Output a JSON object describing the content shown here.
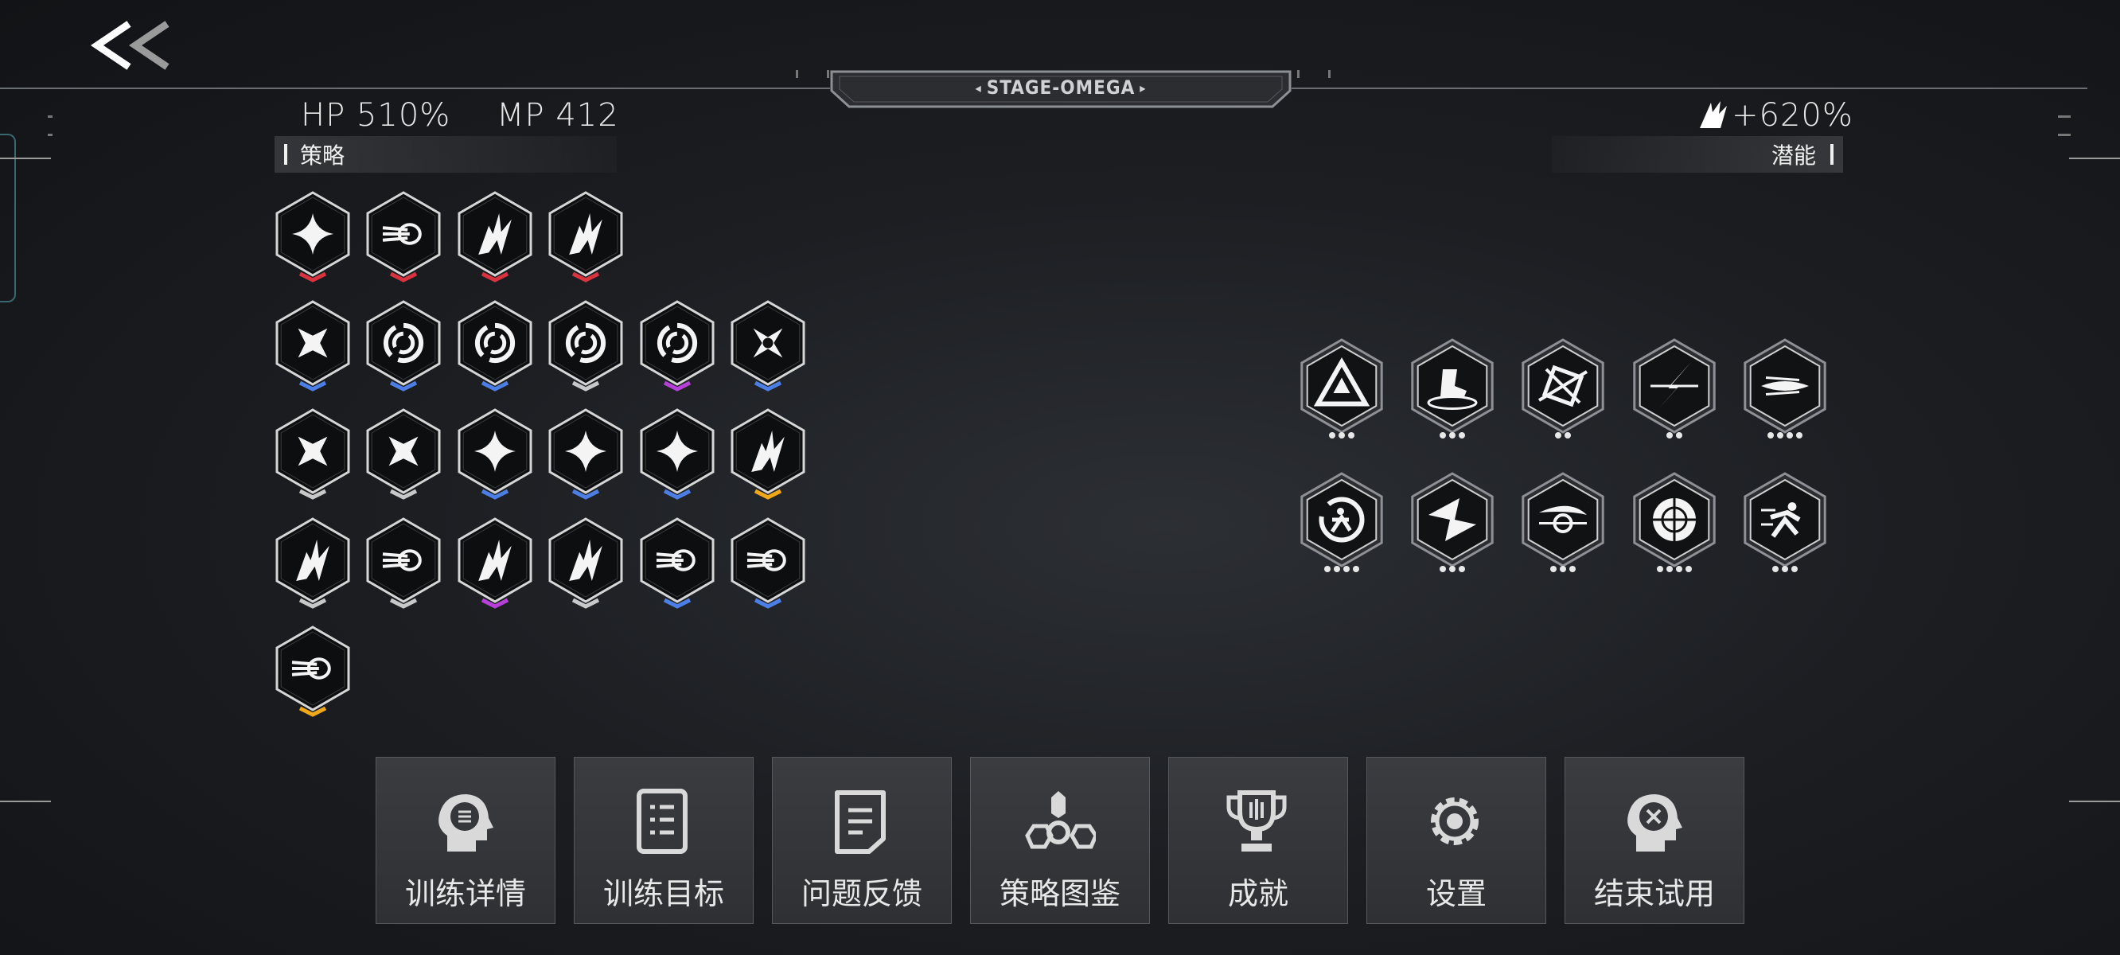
{
  "header": {
    "stage": "STAGE-OMEGA",
    "hp": "HP 510%",
    "mp": "MP 412",
    "boost": "+620%"
  },
  "sections": {
    "strategy": "策略",
    "potential": "潜能"
  },
  "strategy_icons": [
    {
      "row": 0,
      "col": 0,
      "icon": "sparkle-star-icon",
      "tier": "red"
    },
    {
      "row": 0,
      "col": 1,
      "icon": "dash-bolt-icon",
      "tier": "red"
    },
    {
      "row": 0,
      "col": 2,
      "icon": "claw-slash-icon",
      "tier": "red"
    },
    {
      "row": 0,
      "col": 3,
      "icon": "claw-slash-icon",
      "tier": "red"
    },
    {
      "row": 1,
      "col": 0,
      "icon": "shuriken-icon",
      "tier": "blue"
    },
    {
      "row": 1,
      "col": 1,
      "icon": "vortex-icon",
      "tier": "blue"
    },
    {
      "row": 1,
      "col": 2,
      "icon": "vortex-icon",
      "tier": "blue"
    },
    {
      "row": 1,
      "col": 3,
      "icon": "vortex-icon",
      "tier": "white"
    },
    {
      "row": 1,
      "col": 4,
      "icon": "vortex-icon",
      "tier": "purple"
    },
    {
      "row": 1,
      "col": 5,
      "icon": "compass-star-icon",
      "tier": "blue"
    },
    {
      "row": 2,
      "col": 0,
      "icon": "shuriken-icon",
      "tier": "white"
    },
    {
      "row": 2,
      "col": 1,
      "icon": "shuriken-icon",
      "tier": "white"
    },
    {
      "row": 2,
      "col": 2,
      "icon": "sparkle-star-icon",
      "tier": "blue"
    },
    {
      "row": 2,
      "col": 3,
      "icon": "sparkle-star-icon",
      "tier": "blue"
    },
    {
      "row": 2,
      "col": 4,
      "icon": "sparkle-star-icon",
      "tier": "blue"
    },
    {
      "row": 2,
      "col": 5,
      "icon": "claw-slash-icon",
      "tier": "gold"
    },
    {
      "row": 3,
      "col": 0,
      "icon": "claw-slash-icon",
      "tier": "white"
    },
    {
      "row": 3,
      "col": 1,
      "icon": "dash-bolt-icon",
      "tier": "white"
    },
    {
      "row": 3,
      "col": 2,
      "icon": "claw-slash-icon",
      "tier": "purple"
    },
    {
      "row": 3,
      "col": 3,
      "icon": "claw-slash-icon",
      "tier": "white"
    },
    {
      "row": 3,
      "col": 4,
      "icon": "dash-bolt-icon",
      "tier": "blue"
    },
    {
      "row": 3,
      "col": 5,
      "icon": "dash-bolt-icon",
      "tier": "blue"
    },
    {
      "row": 4,
      "col": 0,
      "icon": "dash-bolt-icon",
      "tier": "gold"
    }
  ],
  "potential_icons": [
    {
      "row": 0,
      "col": 0,
      "icon": "triangle-rune-icon",
      "pips": 3
    },
    {
      "row": 0,
      "col": 1,
      "icon": "leap-boot-icon",
      "pips": 3
    },
    {
      "row": 0,
      "col": 2,
      "icon": "square-cross-icon",
      "pips": 2
    },
    {
      "row": 0,
      "col": 3,
      "icon": "lightning-strike-icon",
      "pips": 2
    },
    {
      "row": 0,
      "col": 4,
      "icon": "wind-streak-icon",
      "pips": 4
    },
    {
      "row": 1,
      "col": 0,
      "icon": "runner-orb-icon",
      "pips": 4
    },
    {
      "row": 1,
      "col": 1,
      "icon": "spinning-blade-icon",
      "pips": 3
    },
    {
      "row": 1,
      "col": 2,
      "icon": "crescent-wave-icon",
      "pips": 3
    },
    {
      "row": 1,
      "col": 3,
      "icon": "sphere-grid-icon",
      "pips": 4
    },
    {
      "row": 1,
      "col": 4,
      "icon": "sprint-runner-icon",
      "pips": 3
    }
  ],
  "tier_colors": {
    "red": "#d8333f",
    "blue": "#4c7fe6",
    "white": "#c8c8c8",
    "purple": "#b640d8",
    "gold": "#f0a818"
  },
  "menu": [
    {
      "label": "训练详情",
      "icon": "head-list-icon"
    },
    {
      "label": "训练目标",
      "icon": "document-list-icon"
    },
    {
      "label": "问题反馈",
      "icon": "feedback-note-icon"
    },
    {
      "label": "策略图鉴",
      "icon": "tri-node-icon"
    },
    {
      "label": "成就",
      "icon": "trophy-icon"
    },
    {
      "label": "设置",
      "icon": "gear-icon"
    },
    {
      "label": "结束试用",
      "icon": "head-cross-icon"
    }
  ]
}
